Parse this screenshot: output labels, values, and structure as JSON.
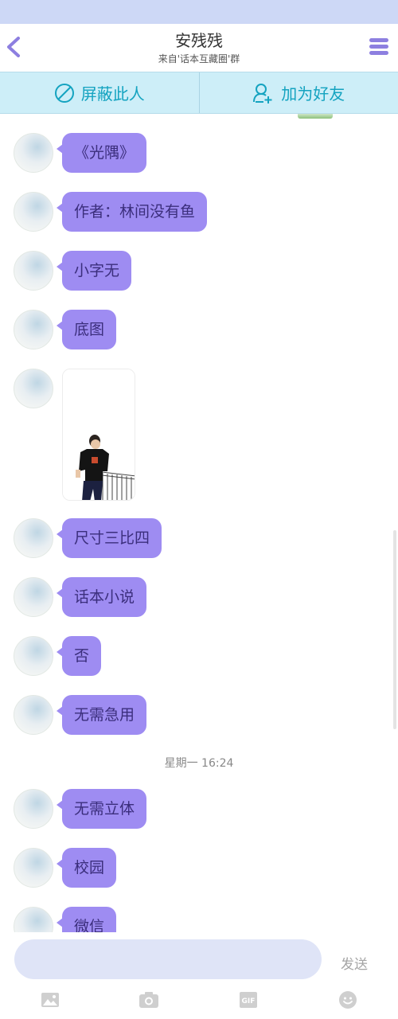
{
  "header": {
    "title": "安残残",
    "subtitle": "来自'话本互藏圈'群"
  },
  "actions": {
    "block_label": "屏蔽此人",
    "add_friend_label": "加为好友"
  },
  "messages": [
    {
      "type": "text",
      "text": "《光隅》"
    },
    {
      "type": "text",
      "text": "作者：林间没有鱼"
    },
    {
      "type": "text",
      "text": "小字无"
    },
    {
      "type": "text",
      "text": "底图"
    },
    {
      "type": "image",
      "description": "photo"
    },
    {
      "type": "text",
      "text": "尺寸三比四"
    },
    {
      "type": "text",
      "text": "话本小说"
    },
    {
      "type": "text",
      "text": "否"
    },
    {
      "type": "text",
      "text": "无需急用"
    },
    {
      "type": "timestamp",
      "text": "星期一 16:24"
    },
    {
      "type": "text",
      "text": "无需立体"
    },
    {
      "type": "text",
      "text": "校园"
    },
    {
      "type": "text",
      "text": "微信"
    }
  ],
  "composer": {
    "input_value": "",
    "send_label": "发送"
  },
  "toolbar": {
    "icons": [
      "image-icon",
      "camera-icon",
      "gif-icon",
      "emoji-icon"
    ],
    "gif_label": "GIF"
  },
  "colors": {
    "accent": "#8d7fe0",
    "bubble": "#9e8cf2",
    "action_bar": "#cdeef8",
    "action_text": "#14a3c0",
    "status_bar": "#cdd8f6",
    "input_bg": "#dfe4f7"
  }
}
